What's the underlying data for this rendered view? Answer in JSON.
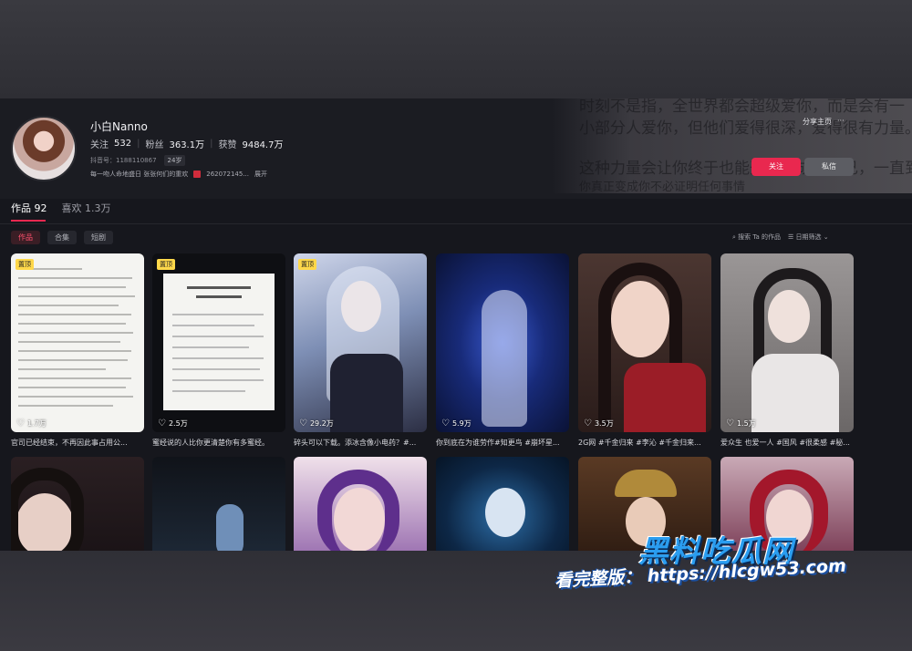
{
  "profile": {
    "name": "小白Nanno",
    "following_label": "关注",
    "following": "532",
    "followers_label": "粉丝",
    "followers": "363.1万",
    "likes_label": "获赞",
    "likes": "9484.7万",
    "uid_label": "抖音号：1188110867",
    "age": "24岁",
    "bio": "每一吻人命地盛日 张张何们的重欢",
    "bio_extra": "262072145...",
    "bio_more": "展开",
    "share_label": "分享主页",
    "more_label": "···",
    "follow_button": "关注",
    "message_button": "私信",
    "bg_text": [
      "时刻不是指，全世界都会超级爱你，而是会有一",
      "小部分人爱你，但他们爱得很深，爱得很有力量。",
      "这种力量会让你终于也能开始变成你自己，一直到",
      "你真正变成你不必证明任何事情"
    ]
  },
  "tabs": [
    {
      "label": "作品 92"
    },
    {
      "label": "喜欢 1.3万"
    }
  ],
  "chips": [
    "作品",
    "合集",
    "短剧"
  ],
  "tools": {
    "search": "搜索 Ta 的作品",
    "filter": "日期筛选"
  },
  "videos": [
    {
      "pinned": "置顶",
      "likes": "1.7万",
      "caption": "官司已经结束，不再因此事占用公...",
      "color": "#f4f4f1"
    },
    {
      "pinned": "置顶",
      "likes": "2.5万",
      "caption": "蜜经说的人比你更清楚你有多蜜经。",
      "color": "#f4f4f1"
    },
    {
      "pinned": "置顶",
      "likes": "29.2万",
      "caption": "碎头可以下载。添冰含像小电药？#...",
      "color": "#8fa3c4"
    },
    {
      "pinned": "",
      "likes": "5.9万",
      "caption": "你到底在为谁劳作#知更鸟 #崩坏星...",
      "color": "#1c2a6e"
    },
    {
      "pinned": "",
      "likes": "3.5万",
      "caption": "2G网 #千金归来 #李沁 #千金归来...",
      "color": "#5a3a32"
    },
    {
      "pinned": "",
      "likes": "1.5万",
      "caption": "爱众生 也爱一人 #国风 #很柔感 #秘...",
      "color": "#8a8588"
    },
    {
      "color": "#2a1f22"
    },
    {
      "color": "#1a2431"
    },
    {
      "color": "#6b4d8a"
    },
    {
      "color": "#0f2a4a"
    },
    {
      "color": "#6d4a30"
    },
    {
      "color": "#8a3b55"
    }
  ],
  "watermark": {
    "title": "黑料吃瓜网",
    "url_line": "看完整版： https://hlcgw53.com"
  }
}
